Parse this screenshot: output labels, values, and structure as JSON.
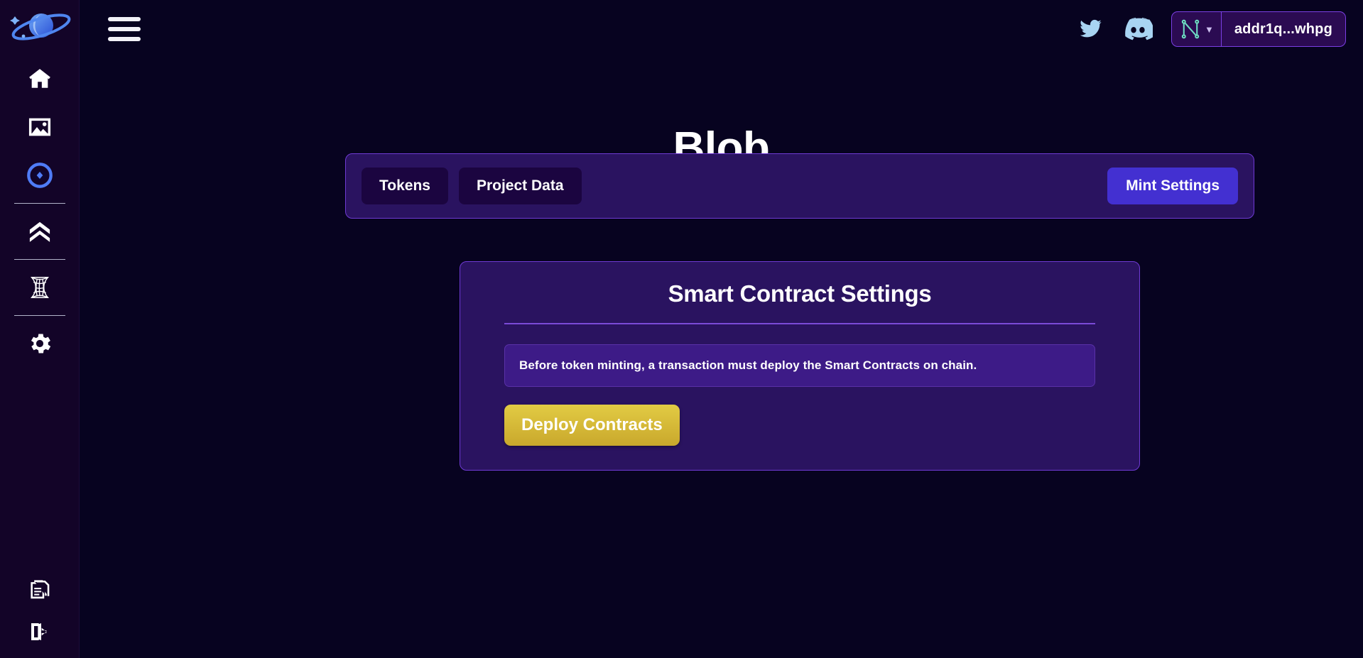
{
  "app": {
    "brand_logo": "planet-saturn-logo",
    "background_color": "#070320",
    "panel_color": "#2a1360",
    "accent_purple": "#7b3fe4",
    "accent_blue": "#4330d1",
    "accent_gold": "#e2cb44"
  },
  "sidebar": {
    "items": [
      {
        "name": "home",
        "icon": "home-icon",
        "label": "Home",
        "active": false
      },
      {
        "name": "gallery",
        "icon": "image-icon",
        "label": "Gallery",
        "active": false
      },
      {
        "name": "mint",
        "icon": "gem-circle-icon",
        "label": "Mint",
        "active": true
      },
      {
        "name": "rank",
        "icon": "double-chevron-up-icon",
        "label": "Rank",
        "active": false
      },
      {
        "name": "wormhole",
        "icon": "wormhole-icon",
        "label": "Wormhole",
        "active": false
      },
      {
        "name": "settings",
        "icon": "gear-icon",
        "label": "Settings",
        "active": false
      }
    ],
    "bottom_items": [
      {
        "name": "docs",
        "icon": "documents-icon",
        "label": "Docs"
      },
      {
        "name": "logout",
        "icon": "logout-icon",
        "label": "Log out"
      }
    ]
  },
  "topbar": {
    "menu_icon": "hamburger-icon",
    "twitter_icon": "twitter-icon",
    "discord_icon": "discord-icon",
    "wallet": {
      "logo": "nami-wallet-icon",
      "chevron": "chevron-down-icon",
      "address": "addr1q...whpg"
    }
  },
  "page": {
    "back_icon": "arrow-left-circle-icon",
    "title": "Blob"
  },
  "tabs": {
    "items": [
      {
        "label": "Tokens",
        "name": "tab-tokens",
        "selected": false
      },
      {
        "label": "Project Data",
        "name": "tab-project-data",
        "selected": false
      }
    ],
    "primary_action": "Mint Settings"
  },
  "card": {
    "title": "Smart Contract Settings",
    "info_text": "Before token minting, a transaction must deploy the Smart Contracts on chain.",
    "action_label": "Deploy Contracts"
  }
}
